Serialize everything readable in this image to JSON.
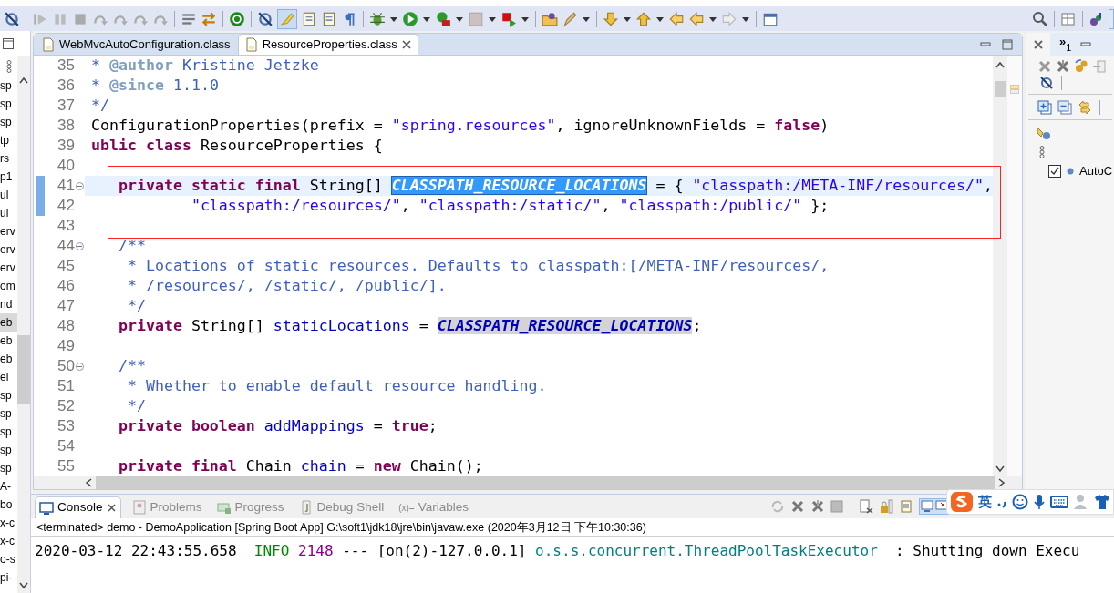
{
  "explorer": {
    "items": [
      {
        "label": "sp",
        "selected": false
      },
      {
        "label": "sp",
        "selected": false
      },
      {
        "label": "sp",
        "selected": false
      },
      {
        "label": "tp",
        "selected": false
      },
      {
        "label": "rs",
        "selected": false
      },
      {
        "label": "p1",
        "selected": false
      },
      {
        "label": "ul",
        "selected": false
      },
      {
        "label": "ul",
        "selected": false
      },
      {
        "label": "erv",
        "selected": false
      },
      {
        "label": "erv",
        "selected": false
      },
      {
        "label": "erv",
        "selected": false
      },
      {
        "label": "om",
        "selected": false
      },
      {
        "label": "nd",
        "selected": false
      },
      {
        "label": "eb",
        "selected": true
      },
      {
        "label": "eb",
        "selected": false
      },
      {
        "label": "eb",
        "selected": false
      },
      {
        "label": "el",
        "selected": false
      },
      {
        "label": "sp",
        "selected": false
      },
      {
        "label": "sp",
        "selected": false
      },
      {
        "label": "sp",
        "selected": false
      },
      {
        "label": "sp",
        "selected": false
      },
      {
        "label": "sp",
        "selected": false
      },
      {
        "label": "A-",
        "selected": false
      },
      {
        "label": "bo",
        "selected": false
      },
      {
        "label": "x-c",
        "selected": false
      },
      {
        "label": "x-c",
        "selected": false
      },
      {
        "label": "o-s",
        "selected": false
      },
      {
        "label": "pi-",
        "selected": false
      }
    ]
  },
  "editor": {
    "tabs": [
      {
        "label": "WebMvcAutoConfiguration.class",
        "selected": false
      },
      {
        "label": "ResourceProperties.class",
        "selected": true
      }
    ],
    "lines": [
      {
        "number": "35",
        "current": false,
        "changed": false,
        "segments": [
          {
            "text": "* ",
            "kind": "doc"
          },
          {
            "text": "@author",
            "kind": "doctag"
          },
          {
            "text": " Kristine Jetzke",
            "kind": "doc"
          }
        ]
      },
      {
        "number": "36",
        "current": false,
        "changed": false,
        "segments": [
          {
            "text": "* ",
            "kind": "doc"
          },
          {
            "text": "@since",
            "kind": "doctag"
          },
          {
            "text": " 1.1.0",
            "kind": "doc"
          }
        ]
      },
      {
        "number": "37",
        "current": false,
        "changed": false,
        "segments": [
          {
            "text": "*/",
            "kind": "doc"
          }
        ]
      },
      {
        "number": "38",
        "current": false,
        "changed": false,
        "segments": [
          {
            "text": "ConfigurationProperties(prefix = ",
            "kind": "plain"
          },
          {
            "text": "\"spring.resources\"",
            "kind": "str"
          },
          {
            "text": ", ignoreUnknownFields = ",
            "kind": "plain"
          },
          {
            "text": "false",
            "kind": "kw"
          },
          {
            "text": ")",
            "kind": "plain"
          }
        ]
      },
      {
        "number": "39",
        "current": false,
        "changed": false,
        "segments": [
          {
            "text": "ublic class",
            "kind": "kw"
          },
          {
            "text": " ResourceProperties {",
            "kind": "plain"
          }
        ]
      },
      {
        "number": "40",
        "current": false,
        "changed": false
      },
      {
        "number": "41",
        "current": true,
        "changed": true,
        "expanded": true,
        "segments": [
          {
            "text": "   private static final",
            "kind": "kw"
          },
          {
            "text": " String[] ",
            "kind": "plain"
          },
          {
            "text": "CLASSPATH_RESOURCE_LOCATIONS",
            "kind": "field",
            "selected": true
          },
          {
            "text": " = { ",
            "kind": "plain"
          },
          {
            "text": "\"classpath:/META-INF/resources/\"",
            "kind": "str"
          },
          {
            "text": ",",
            "kind": "plain"
          }
        ]
      },
      {
        "number": "42",
        "current": false,
        "changed": true,
        "segments": [
          {
            "text": "           \"classpath:/resources/\"",
            "kind": "str"
          },
          {
            "text": ", ",
            "kind": "plain"
          },
          {
            "text": "\"classpath:/static/\"",
            "kind": "str"
          },
          {
            "text": ", ",
            "kind": "plain"
          },
          {
            "text": "\"classpath:/public/\"",
            "kind": "str"
          },
          {
            "text": " };",
            "kind": "plain"
          }
        ]
      },
      {
        "number": "43",
        "current": false,
        "changed": false
      },
      {
        "number": "44",
        "current": false,
        "changed": false,
        "expanded": true,
        "segments": [
          {
            "text": "   /**",
            "kind": "doc"
          }
        ]
      },
      {
        "number": "45",
        "current": false,
        "changed": false,
        "segments": [
          {
            "text": "    * Locations of static resources. Defaults to classpath:[/META-INF/resources/,",
            "kind": "doc"
          }
        ]
      },
      {
        "number": "46",
        "current": false,
        "changed": false,
        "segments": [
          {
            "text": "    * /resources/, /static/, /public/].",
            "kind": "doc"
          }
        ]
      },
      {
        "number": "47",
        "current": false,
        "changed": false,
        "segments": [
          {
            "text": "    */",
            "kind": "doc"
          }
        ]
      },
      {
        "number": "48",
        "current": false,
        "changed": false,
        "segments": [
          {
            "text": "   private",
            "kind": "kw"
          },
          {
            "text": " String[] ",
            "kind": "plain"
          },
          {
            "text": "staticLocations",
            "kind": "member"
          },
          {
            "text": " = ",
            "kind": "plain"
          },
          {
            "text": "CLASSPATH_RESOURCE_LOCATIONS",
            "kind": "field",
            "occurrence": true
          },
          {
            "text": ";",
            "kind": "plain"
          }
        ]
      },
      {
        "number": "49",
        "current": false,
        "changed": false
      },
      {
        "number": "50",
        "current": false,
        "changed": false,
        "expanded": true,
        "segments": [
          {
            "text": "   /**",
            "kind": "doc"
          }
        ]
      },
      {
        "number": "51",
        "current": false,
        "changed": false,
        "segments": [
          {
            "text": "    * Whether to enable default resource handling.",
            "kind": "doc"
          }
        ]
      },
      {
        "number": "52",
        "current": false,
        "changed": false,
        "segments": [
          {
            "text": "    */",
            "kind": "doc"
          }
        ]
      },
      {
        "number": "53",
        "current": false,
        "changed": false,
        "segments": [
          {
            "text": "   private boolean ",
            "kind": "kw"
          },
          {
            "text": "addMappings",
            "kind": "member"
          },
          {
            "text": " = ",
            "kind": "plain"
          },
          {
            "text": "true",
            "kind": "kw"
          },
          {
            "text": ";",
            "kind": "plain"
          }
        ]
      },
      {
        "number": "54",
        "current": false,
        "changed": false
      },
      {
        "number": "55",
        "current": false,
        "changed": false,
        "segments": [
          {
            "text": "   private final",
            "kind": "kw"
          },
          {
            "text": " Chain ",
            "kind": "plain"
          },
          {
            "text": "chain",
            "kind": "member"
          },
          {
            "text": " = ",
            "kind": "plain"
          },
          {
            "text": "new",
            "kind": "kw"
          },
          {
            "text": " Chain();",
            "kind": "plain"
          }
        ]
      }
    ]
  },
  "side_panel": {
    "chevron": "»",
    "count": "1",
    "items": [
      {
        "label": "AutoC",
        "checked": true
      }
    ]
  },
  "console": {
    "tabs": [
      {
        "label": "Console",
        "selected": true
      },
      {
        "label": "Problems",
        "selected": false
      },
      {
        "label": "Progress",
        "selected": false
      },
      {
        "label": "Debug Shell",
        "selected": false
      },
      {
        "label": "Variables",
        "icon_text": "(x)=",
        "selected": false
      }
    ],
    "status": "<terminated> demo - DemoApplication [Spring Boot App] G:\\soft1\\jdk18\\jre\\bin\\javaw.exe (2020年3月12日 下午10:30:36)",
    "output": [
      {
        "text": "2020-03-12 22:43:55.658  ",
        "kind": "plain"
      },
      {
        "text": "INFO",
        "kind": "level"
      },
      {
        "text": " 2148",
        "kind": "pid"
      },
      {
        "text": " --- [on(2)-127.0.0.1] ",
        "kind": "plain"
      },
      {
        "text": "o.s.s.concurrent.ThreadPoolTaskExecutor",
        "kind": "logger"
      },
      {
        "text": "  : Shutting down Execu",
        "kind": "plain"
      }
    ]
  },
  "ime": {
    "mode": "英"
  }
}
